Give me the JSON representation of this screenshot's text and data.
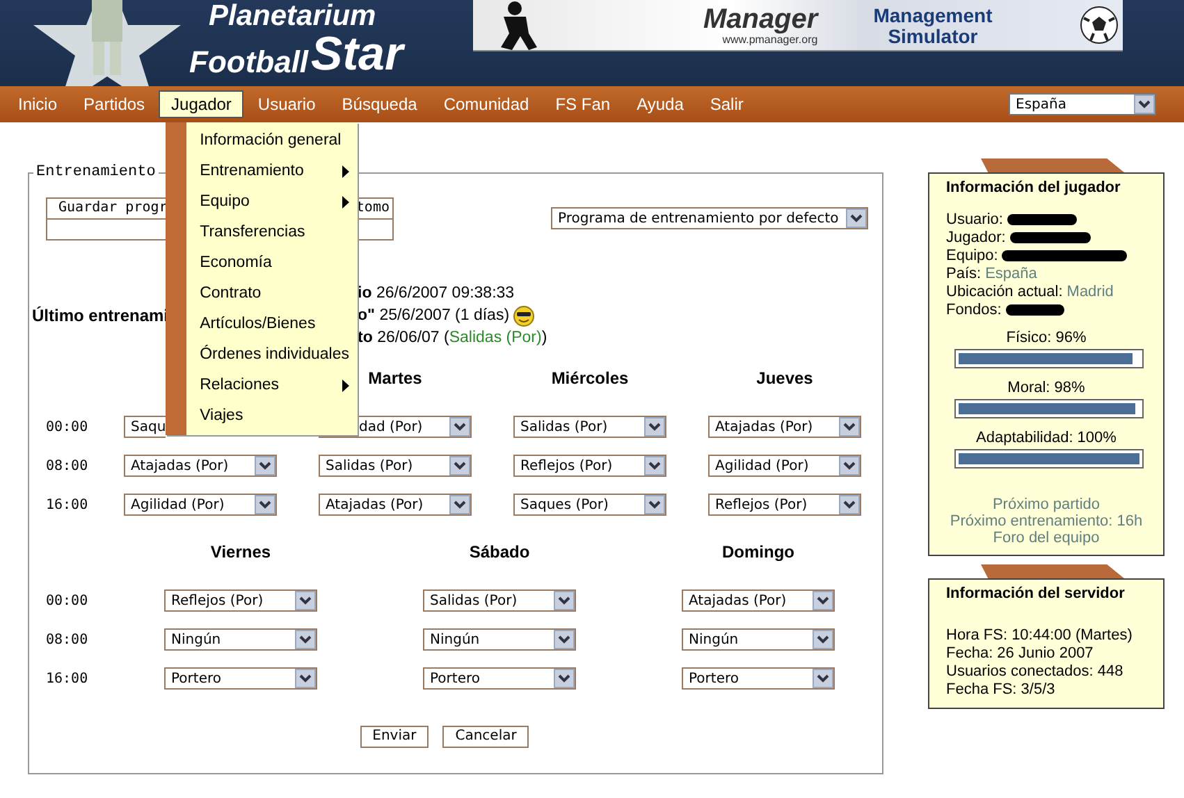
{
  "header": {
    "logo_lines": [
      "Planetarium",
      "Football",
      "Star"
    ],
    "banner": {
      "brand": "Manager",
      "url": "www.pmanager.org",
      "title_lines": [
        "Management",
        "Simulator"
      ]
    }
  },
  "nav": {
    "items": [
      {
        "label": "Inicio",
        "selected": false
      },
      {
        "label": "Partidos",
        "selected": false
      },
      {
        "label": "Jugador",
        "selected": true
      },
      {
        "label": "Usuario",
        "selected": false
      },
      {
        "label": "Búsqueda",
        "selected": false
      },
      {
        "label": "Comunidad",
        "selected": false
      },
      {
        "label": "FS Fan",
        "selected": false
      },
      {
        "label": "Ayuda",
        "selected": false
      },
      {
        "label": "Salir",
        "selected": false
      }
    ],
    "country_select": "España"
  },
  "menu": {
    "items": [
      {
        "label": "Información general",
        "submenu": false
      },
      {
        "label": "Entrenamiento",
        "submenu": true
      },
      {
        "label": "Equipo",
        "submenu": true
      },
      {
        "label": "Transferencias",
        "submenu": false
      },
      {
        "label": "Economía",
        "submenu": false
      },
      {
        "label": "Contrato",
        "submenu": false
      },
      {
        "label": "Artículos/Bienes",
        "submenu": false
      },
      {
        "label": "Órdenes individuales",
        "submenu": false
      },
      {
        "label": "Relaciones",
        "submenu": true
      },
      {
        "label": "Viajes",
        "submenu": false
      }
    ]
  },
  "training": {
    "legend": "Entrenamiento",
    "save_button": [
      "Guardar progr",
      "tomo"
    ],
    "program_select": "Programa de entrenamiento por defecto",
    "last_training_label": "Último entrenami",
    "info_lines": [
      {
        "label": "io",
        "text": "26/6/2007 09:38:33"
      },
      {
        "label": "o\"",
        "text": "25/6/2007 (1 días)",
        "smiley": true
      },
      {
        "label": "to",
        "text": "26/06/07 (",
        "link": "Salidas (Por)",
        "suffix": ")"
      }
    ],
    "blocks": [
      {
        "times": [
          "00:00",
          "08:00",
          "16:00"
        ],
        "days": [
          {
            "slots": [
              {
                "value": "Saqu",
                "covered_start": false,
                "covered_end": true
              },
              {
                "value": "Atajadas (Por)",
                "covered_start": false,
                "covered_end": false
              },
              {
                "value": "Agilidad (Por)",
                "covered_start": false,
                "covered_end": false
              }
            ]
          },
          {
            "name": "Martes",
            "slots": [
              {
                "value": "dad (Por)",
                "covered_start": true,
                "covered_end": false
              },
              {
                "value": "Salidas (Por)",
                "covered_start": false,
                "covered_end": false
              },
              {
                "value": "Atajadas (Por)",
                "covered_start": false,
                "covered_end": false
              }
            ]
          },
          {
            "name": "Miércoles",
            "slots": [
              {
                "value": "Salidas (Por)",
                "covered_start": false,
                "covered_end": false
              },
              {
                "value": "Reflejos (Por)",
                "covered_start": false,
                "covered_end": false
              },
              {
                "value": "Saques (Por)",
                "covered_start": false,
                "covered_end": false
              }
            ]
          },
          {
            "name": "Jueves",
            "slots": [
              {
                "value": "Atajadas (Por)",
                "covered_start": false,
                "covered_end": false
              },
              {
                "value": "Agilidad (Por)",
                "covered_start": false,
                "covered_end": false
              },
              {
                "value": "Reflejos (Por)",
                "covered_start": false,
                "covered_end": false
              }
            ]
          }
        ]
      },
      {
        "times": [
          "00:00",
          "08:00",
          "16:00"
        ],
        "days": [
          {
            "name": "Viernes",
            "slots": [
              {
                "value": "Reflejos (Por)",
                "covered_start": false,
                "covered_end": false
              },
              {
                "value": "Ningún",
                "covered_start": false,
                "covered_end": false
              },
              {
                "value": "Portero",
                "covered_start": false,
                "covered_end": false
              }
            ]
          },
          {
            "name": "Sábado",
            "slots": [
              {
                "value": "Salidas (Por)",
                "covered_start": false,
                "covered_end": false
              },
              {
                "value": "Ningún",
                "covered_start": false,
                "covered_end": false
              },
              {
                "value": "Portero",
                "covered_start": false,
                "covered_end": false
              }
            ]
          },
          {
            "name": "Domingo",
            "slots": [
              {
                "value": "Atajadas (Por)",
                "covered_start": false,
                "covered_end": false
              },
              {
                "value": "Ningún",
                "covered_start": false,
                "covered_end": false
              },
              {
                "value": "Portero",
                "covered_start": false,
                "covered_end": false
              }
            ]
          }
        ]
      }
    ],
    "buttons": [
      "Enviar",
      "Cancelar"
    ]
  },
  "player_card": {
    "title": "Información del jugador",
    "fields": [
      {
        "label": "Usuario:",
        "redacted": true
      },
      {
        "label": "Jugador:",
        "redacted": true
      },
      {
        "label": "Equipo:",
        "redacted": true
      },
      {
        "label": "País:",
        "value": "España",
        "redacted": false
      },
      {
        "label": "Ubicación actual:",
        "value": "Madrid",
        "redacted": false
      },
      {
        "label": "Fondos:",
        "redacted": true
      }
    ],
    "meters": [
      {
        "label": "Físico: 96%",
        "level": 0.96
      },
      {
        "label": "Moral: 98%",
        "level": 0.98
      },
      {
        "label": "Adaptabilidad: 100%",
        "level": 1
      }
    ],
    "links": [
      "Próximo partido",
      "Próximo entrenamiento: 16h",
      "Foro del equipo"
    ]
  },
  "server_card": {
    "title": "Información del servidor",
    "lines": [
      "Hora FS: 10:44:00 (Martes)",
      "Fecha: 26 Junio 2007",
      "Usuarios conectados: 448",
      "Fecha FS: 3/5/3"
    ]
  }
}
